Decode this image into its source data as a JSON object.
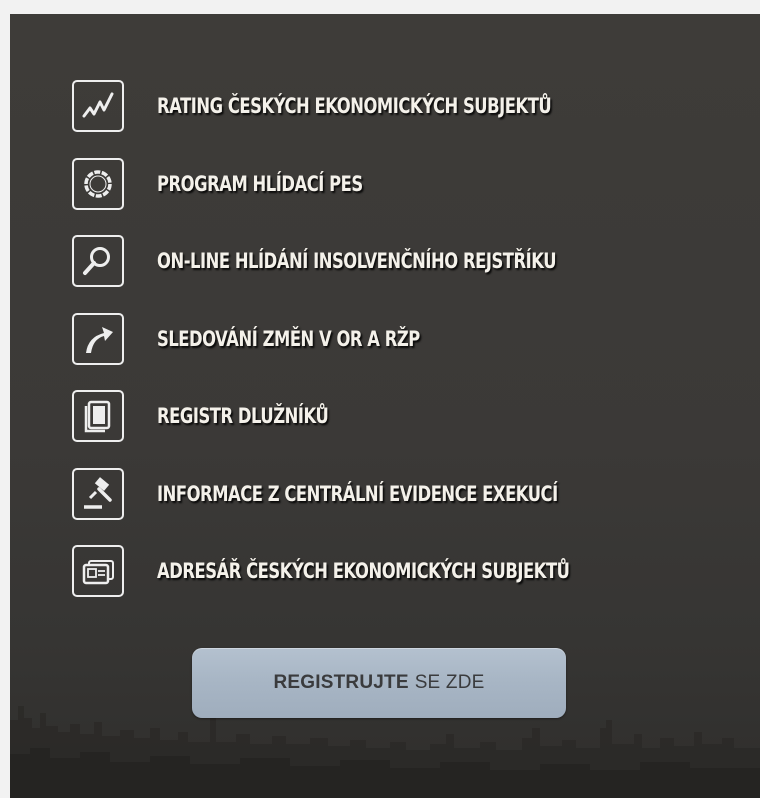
{
  "features": [
    {
      "label": "RATING ČESKÝCH EKONOMICKÝCH SUBJEKTŮ",
      "icon": "chart-line-icon"
    },
    {
      "label": "PROGRAM HLÍDACÍ PES",
      "icon": "watchdog-ring-icon"
    },
    {
      "label": "ON-LINE HLÍDÁNÍ INSOLVENČNÍHO REJSTŘÍKU",
      "icon": "magnifier-icon"
    },
    {
      "label": "SLEDOVÁNÍ ZMĚN V OR A RŽP",
      "icon": "curved-arrow-icon"
    },
    {
      "label": "REGISTR DLUŽNÍKŮ",
      "icon": "documents-icon"
    },
    {
      "label": "INFORMACE Z CENTRÁLNÍ EVIDENCE EXEKUCÍ",
      "icon": "gavel-icon"
    },
    {
      "label": "ADRESÁŘ ČESKÝCH EKONOMICKÝCH SUBJEKTŮ",
      "icon": "address-card-icon"
    }
  ],
  "register_button": {
    "bold_text": "REGISTRUJTE",
    "text": "SE ZDE"
  },
  "colors": {
    "panel_background": "#3b3937",
    "label_text": "#f4f1ea",
    "icon_stroke": "#eeeeee",
    "button_background": "#a8b6c5",
    "button_text": "#3a3b3d",
    "page_background": "#f2f2f2"
  }
}
